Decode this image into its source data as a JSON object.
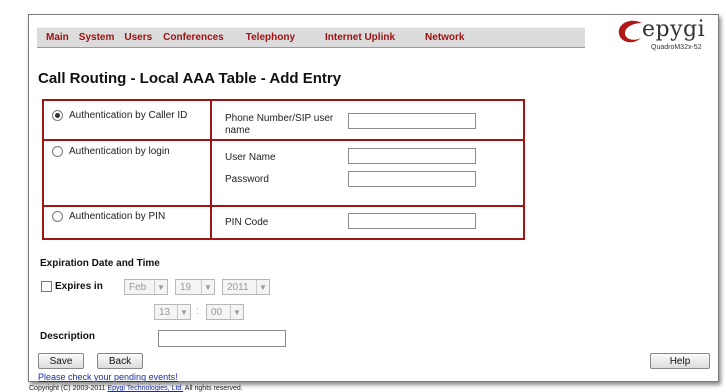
{
  "nav": {
    "items": [
      "Main",
      "System",
      "Users",
      "Conferences",
      "Telephony",
      "Internet Uplink",
      "Network"
    ]
  },
  "logo": {
    "brand": "epygi",
    "model": "QuadroM32x-52",
    "brand_color": "#b01818"
  },
  "page": {
    "title": "Call Routing - Local AAA Table - Add Entry"
  },
  "auth": {
    "options": [
      {
        "label": "Authentication by Caller ID",
        "selected": true
      },
      {
        "label": "Authentication by login",
        "selected": false
      },
      {
        "label": "Authentication by PIN",
        "selected": false
      }
    ],
    "fields": {
      "phone_label": "Phone Number/SIP user name",
      "phone_value": "",
      "username_label": "User Name",
      "username_value": "",
      "password_label": "Password",
      "password_value": "",
      "pin_label": "PIN Code",
      "pin_value": ""
    },
    "border_color": "#a01414"
  },
  "expiration": {
    "title": "Expiration Date and Time",
    "expires_label": "Expires in",
    "expires_checked": false,
    "month": "Feb",
    "day": "19",
    "year": "2011",
    "hour": "13",
    "minute": "00",
    "separator": ":"
  },
  "description": {
    "label": "Description",
    "value": ""
  },
  "buttons": {
    "save": "Save",
    "back": "Back",
    "help": "Help"
  },
  "footer": {
    "pending_link": "Please check your pending events!",
    "copyright_prefix": "Copyright (C) 2003-2011 ",
    "company_link": "Epygi Technologies, Ltd.",
    "copyright_suffix": " All rights reserved."
  }
}
